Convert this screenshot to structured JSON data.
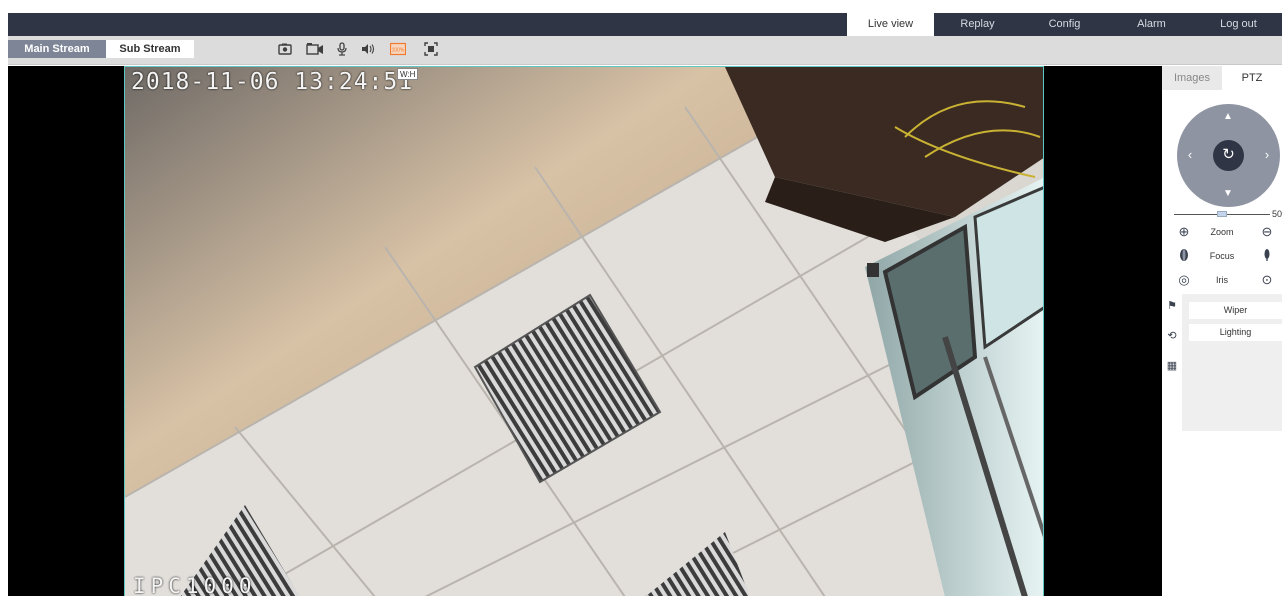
{
  "nav": {
    "tabs": [
      {
        "label": "Live view",
        "active": true
      },
      {
        "label": "Replay",
        "active": false
      },
      {
        "label": "Config",
        "active": false
      },
      {
        "label": "Alarm",
        "active": false
      },
      {
        "label": "Log out",
        "active": false
      }
    ]
  },
  "toolbar": {
    "main_stream_label": "Main Stream",
    "sub_stream_label": "Sub Stream",
    "icons": [
      "snapshot-icon",
      "record-icon",
      "microphone-icon",
      "audio-icon",
      "ratio-icon",
      "fullscreen-icon"
    ],
    "ratio_tooltip": "W:H",
    "ratio_badge": "100%"
  },
  "video": {
    "osd_time": "2018-11-06 13:24:51",
    "osd_name": "IPC1000"
  },
  "panel": {
    "tabs": [
      {
        "label": "Images",
        "active": false
      },
      {
        "label": "PTZ",
        "active": true
      }
    ],
    "speed_value": "50",
    "speed_fraction": 0.5,
    "controls": {
      "zoom_label": "Zoom",
      "focus_label": "Focus",
      "iris_label": "Iris"
    },
    "functions": {
      "wiper_label": "Wiper",
      "lighting_label": "Lighting"
    }
  },
  "colors": {
    "nav_bg": "#2f3544",
    "toolbar_bg": "#dcdcdc",
    "main_stream_bg": "#7d8597",
    "joystick_bg": "#8f94a2",
    "frame_border": "#5dc7c2",
    "ratio_icon": "#f07a2e"
  }
}
